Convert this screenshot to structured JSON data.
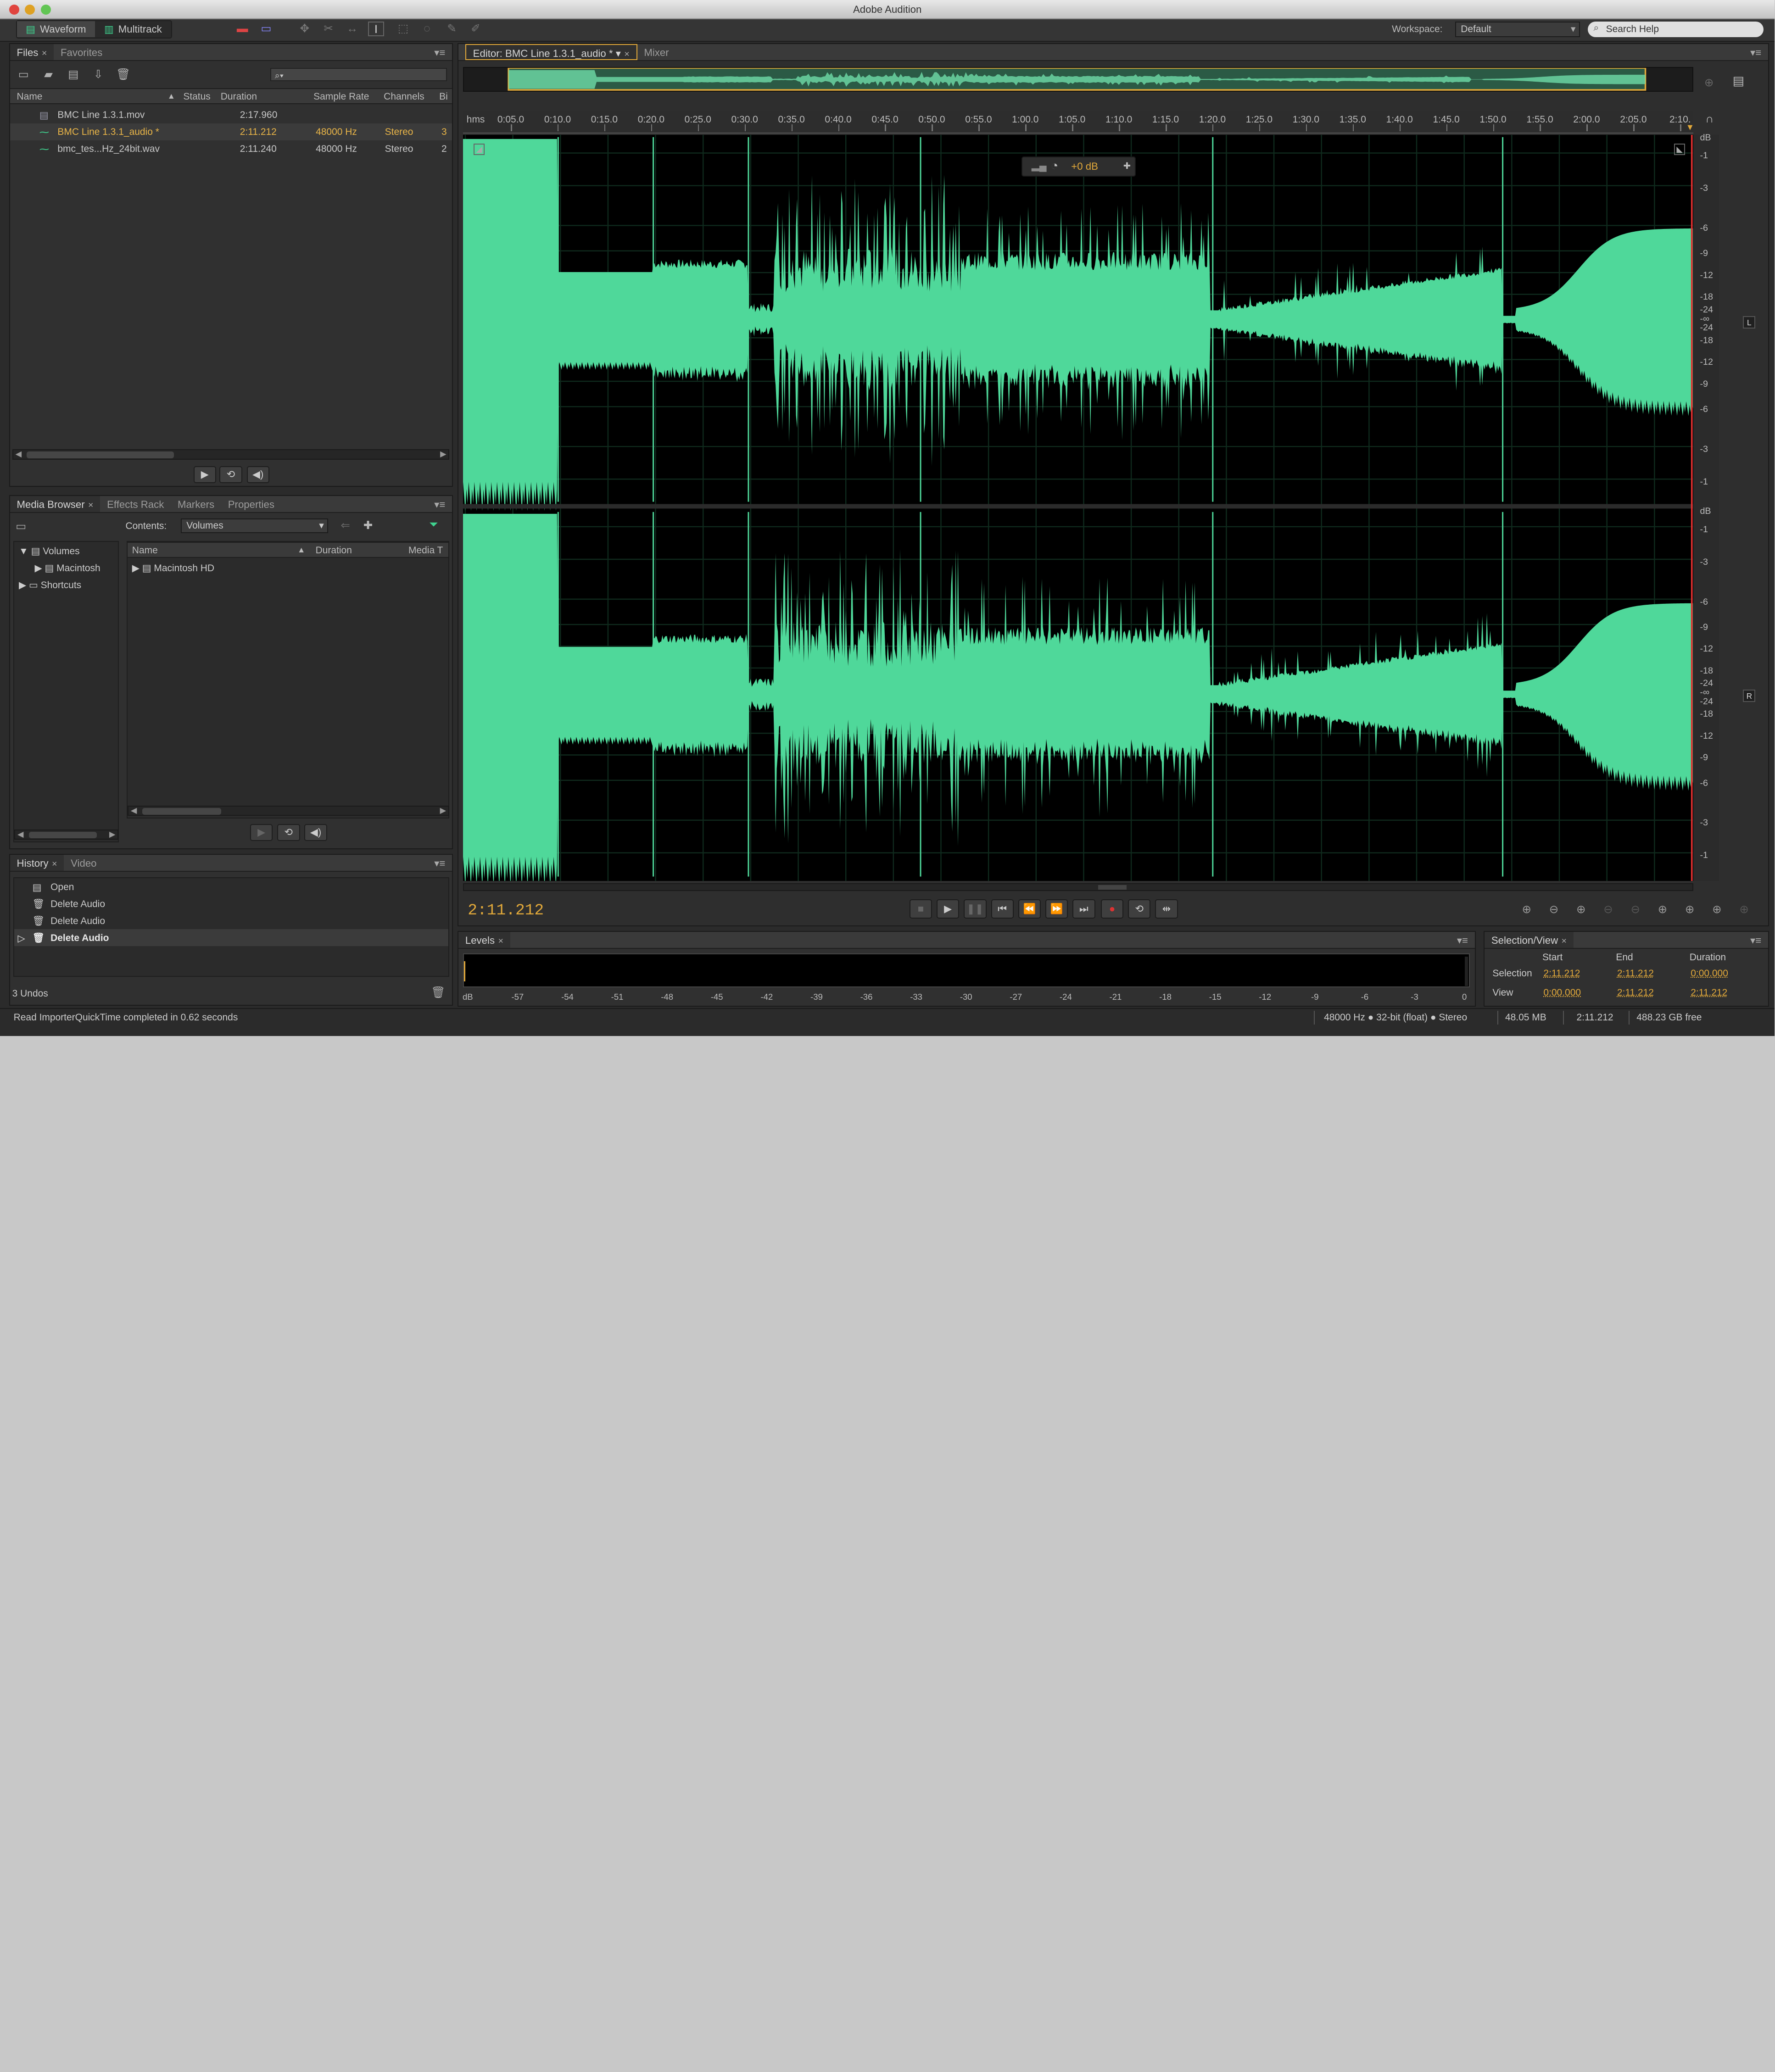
{
  "window": {
    "title": "Adobe Audition"
  },
  "toolbar": {
    "waveform_label": "Waveform",
    "multitrack_label": "Multitrack",
    "workspace_label": "Workspace:",
    "workspace_value": "Default",
    "search_placeholder": "Search Help"
  },
  "files_panel": {
    "tabs": [
      "Files",
      "Favorites"
    ],
    "columns": [
      "Name",
      "Status",
      "Duration",
      "Sample Rate",
      "Channels",
      "Bi"
    ],
    "rows": [
      {
        "name": "BMC Line 1.3.1.mov",
        "status": "",
        "duration": "2:17.960",
        "rate": "",
        "channels": "",
        "bits": "",
        "icon": "video-file-icon",
        "selected": false
      },
      {
        "name": "BMC Line 1.3.1_audio *",
        "status": "",
        "duration": "2:11.212",
        "rate": "48000 Hz",
        "channels": "Stereo",
        "bits": "3",
        "icon": "audio-file-icon",
        "selected": true
      },
      {
        "name": "bmc_tes...Hz_24bit.wav",
        "status": "",
        "duration": "2:11.240",
        "rate": "48000 Hz",
        "channels": "Stereo",
        "bits": "2",
        "icon": "audio-file-icon",
        "selected": false
      }
    ]
  },
  "media_browser": {
    "tabs": [
      "Media Browser",
      "Effects Rack",
      "Markers",
      "Properties"
    ],
    "contents_label": "Contents:",
    "contents_value": "Volumes",
    "tree": [
      "Volumes",
      "Macintosh",
      "Shortcuts"
    ],
    "columns": [
      "Name",
      "Duration",
      "Media T"
    ],
    "rows": [
      "Macintosh HD"
    ]
  },
  "history": {
    "tabs": [
      "History",
      "Video"
    ],
    "items": [
      "Open",
      "Delete Audio",
      "Delete Audio",
      "Delete Audio"
    ],
    "undos": "3 Undos"
  },
  "editor": {
    "tabs": [
      "Editor: BMC Line 1.3.1_audio *",
      "Mixer"
    ],
    "ruler_unit": "hms",
    "ruler_labels": [
      "0:05.0",
      "0:10.0",
      "0:15.0",
      "0:20.0",
      "0:25.0",
      "0:30.0",
      "0:35.0",
      "0:40.0",
      "0:45.0",
      "0:50.0",
      "0:55.0",
      "1:00.0",
      "1:05.0",
      "1:10.0",
      "1:15.0",
      "1:20.0",
      "1:25.0",
      "1:30.0",
      "1:35.0",
      "1:40.0",
      "1:45.0",
      "1:50.0",
      "1:55.0",
      "2:00.0",
      "2:05.0",
      "2:10."
    ],
    "hud_gain": "+0 dB",
    "db_scale": [
      "dB",
      "-1",
      "-3",
      "-6",
      "-9",
      "-12",
      "-18",
      "-24",
      "-∞",
      "-24",
      "-18",
      "-12",
      "-9",
      "-6",
      "-3",
      "-1"
    ],
    "channel_left": "L",
    "channel_right": "R",
    "current_time": "2:11.212",
    "waveform_color": "#4fd89a"
  },
  "levels": {
    "tab": "Levels",
    "scale": [
      "dB",
      "-57",
      "-54",
      "-51",
      "-48",
      "-45",
      "-42",
      "-39",
      "-36",
      "-33",
      "-30",
      "-27",
      "-24",
      "-21",
      "-18",
      "-15",
      "-12",
      "-9",
      "-6",
      "-3",
      "0"
    ]
  },
  "selection_view": {
    "tab": "Selection/View",
    "headers": [
      "Start",
      "End",
      "Duration"
    ],
    "selection": {
      "label": "Selection",
      "start": "2:11.212",
      "end": "2:11.212",
      "duration": "0:00.000"
    },
    "view": {
      "label": "View",
      "start": "0:00.000",
      "end": "2:11.212",
      "duration": "2:11.212"
    }
  },
  "status": {
    "message": "Read ImporterQuickTime completed in 0.62 seconds",
    "format": "48000 Hz ● 32-bit (float) ● Stereo",
    "size": "48.05 MB",
    "duration": "2:11.212",
    "free": "488.23 GB free"
  },
  "colors": {
    "accent": "#e2a93a",
    "waveform": "#4fd89a"
  }
}
